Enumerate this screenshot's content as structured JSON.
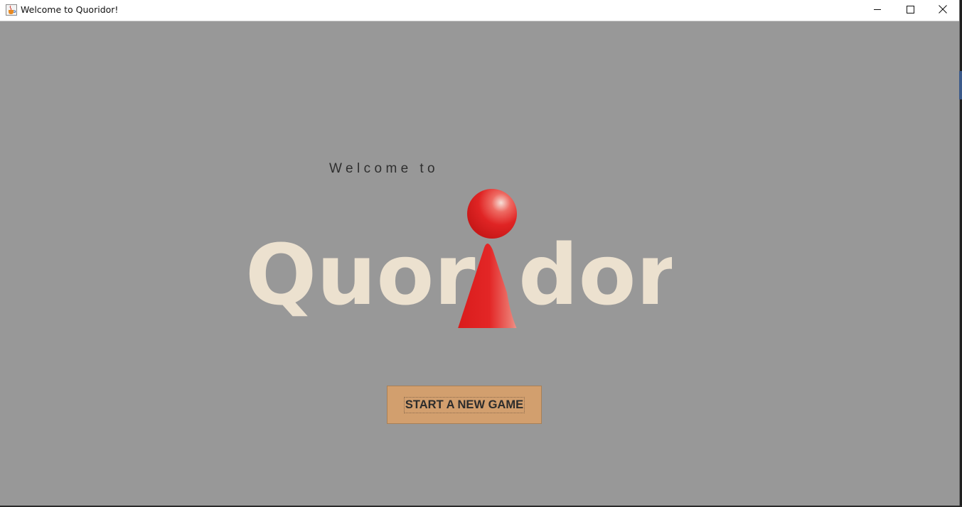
{
  "window": {
    "title": "Welcome to Quoridor!"
  },
  "icons": {
    "app": "java-cup-icon",
    "minimize": "minimize-icon",
    "maximize": "maximize-icon",
    "close": "close-icon"
  },
  "welcome": {
    "intro": "Welcome to",
    "logo_text": "Quoridor",
    "logo_pawn": "pawn-icon"
  },
  "actions": {
    "start_label": "START A NEW GAME"
  },
  "colors": {
    "background": "#989898",
    "logo": "#ece1cf",
    "pawn": "#e02424",
    "button": "#d29f6e"
  }
}
